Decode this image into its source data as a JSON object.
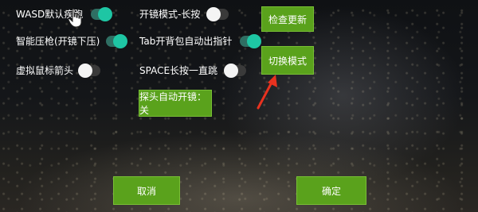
{
  "options": [
    {
      "label": "WASD默认疾跑",
      "state": "on"
    },
    {
      "label": "智能压枪(开镜下压)",
      "state": "on"
    },
    {
      "label": "虚拟鼠标箭头",
      "state": "off"
    },
    {
      "label": "开镜模式-长按",
      "state": "off"
    },
    {
      "label": "Tab开背包自动出指针",
      "state": "on"
    },
    {
      "label": "SPACE长按一直跳",
      "state": "off"
    }
  ],
  "buttons": {
    "check_update": "检查更新",
    "switch_mode": "切换模式",
    "probe_scope": "探头自动开镜：关",
    "cancel": "取消",
    "confirm": "确定"
  },
  "colors": {
    "button_green": "#5aa21c",
    "toggle_on": "#1ec6a4",
    "toggle_off_knob": "#f4f4f4",
    "annotation_arrow": "#e8321f"
  },
  "icons": {
    "cursor": "hand-pointer-icon",
    "annotation": "red-arrow-icon"
  }
}
